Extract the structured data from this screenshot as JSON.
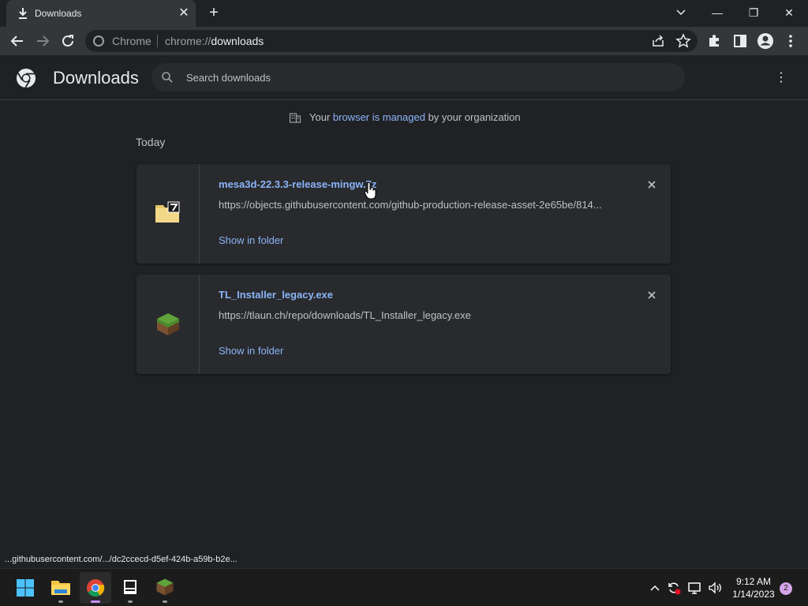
{
  "tab": {
    "title": "Downloads",
    "close_label": "✕",
    "new_tab_label": "+"
  },
  "window": {
    "minimize": "—",
    "restore": "❐",
    "close": "✕"
  },
  "omnibox": {
    "chip": "Chrome",
    "url_prefix": "chrome://",
    "url_path": "downloads"
  },
  "header": {
    "title": "Downloads",
    "search_placeholder": "Search downloads",
    "menu_label": "⋮"
  },
  "managed": {
    "prefix": "Your ",
    "link": "browser is managed",
    "suffix": " by your organization"
  },
  "section_label": "Today",
  "downloads": [
    {
      "name": "mesa3d-22.3.3-release-mingw.7z",
      "url": "https://objects.githubusercontent.com/github-production-release-asset-2e65be/814...",
      "action": "Show in folder",
      "icon": "7z-archive-icon"
    },
    {
      "name": "TL_Installer_legacy.exe",
      "url": "https://tlaun.ch/repo/downloads/TL_Installer_legacy.exe",
      "action": "Show in folder",
      "icon": "grass-block-icon"
    }
  ],
  "status_bar": "...githubusercontent.com/.../dc2ccecd-d5ef-424b-a59b-b2e...",
  "taskbar": {
    "time": "9:12 AM",
    "date": "1/14/2023",
    "notification_count": "2"
  },
  "colors": {
    "background": "#202124",
    "card": "#292a2d",
    "link": "#8ab4f8",
    "toolbar": "#35363a"
  }
}
